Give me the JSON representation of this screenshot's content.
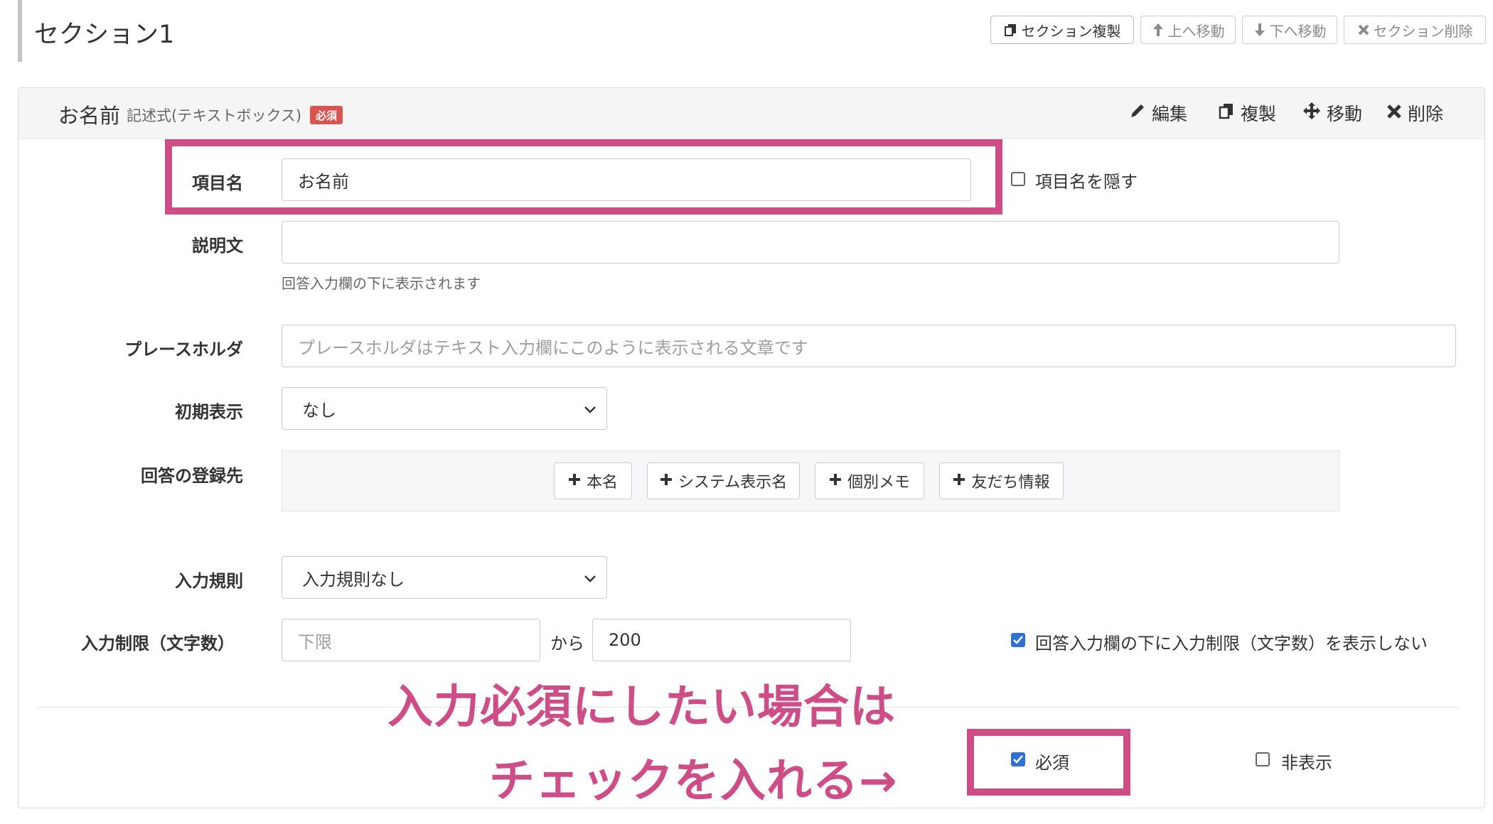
{
  "section": {
    "title": "セクション1",
    "buttons": [
      {
        "label": "セクション複製",
        "icon": "copy-icon"
      },
      {
        "label": "上へ移動",
        "icon": "arrow-up-icon"
      },
      {
        "label": "下へ移動",
        "icon": "arrow-down-icon"
      },
      {
        "label": "セクション削除",
        "icon": "close-icon"
      }
    ]
  },
  "item": {
    "title": "お名前",
    "type": "記述式(テキストボックス)",
    "required_badge": "必須",
    "actions": [
      {
        "label": "編集",
        "icon": "pencil-icon"
      },
      {
        "label": "複製",
        "icon": "copy-icon"
      },
      {
        "label": "移動",
        "icon": "move-icon"
      },
      {
        "label": "削除",
        "icon": "close-icon"
      }
    ]
  },
  "form": {
    "name": {
      "label": "項目名",
      "value": "お名前",
      "hide_label": "項目名を隠す",
      "hide_checked": false
    },
    "description": {
      "label": "説明文",
      "value": "",
      "help": "回答入力欄の下に表示されます"
    },
    "placeholder": {
      "label": "プレースホルダ",
      "placeholder": "プレースホルダはテキスト入力欄にこのように表示される文章です"
    },
    "initial": {
      "label": "初期表示",
      "selected": "なし"
    },
    "register": {
      "label": "回答の登録先",
      "buttons": [
        "本名",
        "システム表示名",
        "個別メモ",
        "友だち情報"
      ]
    },
    "rule": {
      "label": "入力規則",
      "selected": "入力規則なし"
    },
    "limit": {
      "label": "入力制限（文字数）",
      "min_placeholder": "下限",
      "separator": "から",
      "max_value": "200",
      "hide_limit_label": "回答入力欄の下に入力制限（文字数）を表示しない",
      "hide_limit_checked": true
    }
  },
  "footer": {
    "required_label": "必須",
    "required_checked": true,
    "hidden_label": "非表示",
    "hidden_checked": false
  },
  "annotation": {
    "line1": "入力必須にしたい場合は",
    "line2": "チェックを入れる→"
  },
  "colors": {
    "accent": "#cf4d86",
    "badge": "#d9534f",
    "checkbox": "#2f6fd6"
  }
}
